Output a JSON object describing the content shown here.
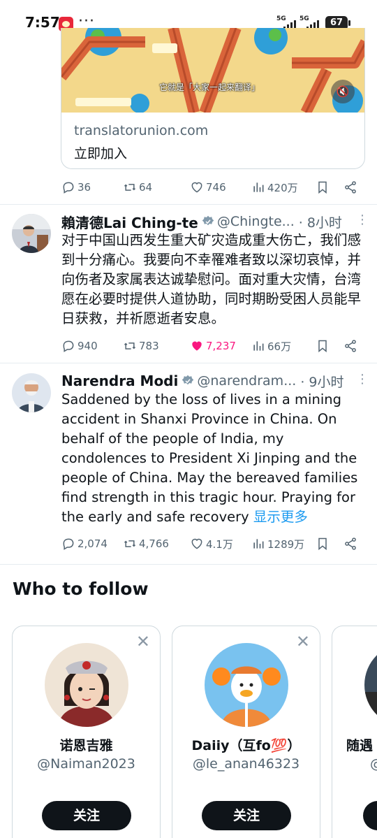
{
  "status_bar": {
    "time": "7:57",
    "dots": "···",
    "network1": "5G",
    "network2": "5G",
    "battery": "67"
  },
  "embed_card": {
    "subtitle": "它就是「大家一起来翻译」",
    "domain": "translatorunion.com",
    "title": "立即加入"
  },
  "tweet0_actions": {
    "replies": "36",
    "retweets": "64",
    "likes": "746",
    "views": "420万"
  },
  "tweets": [
    {
      "name": "賴清德Lai Ching-te",
      "handle": "@Chingte...",
      "time": "· 8小时",
      "more": "⋮",
      "text": "对于中国山西发生重大矿灾造成重大伤亡，我们感到十分痛心。我要向不幸罹难者致以深切哀悼，并向伤者及家属表达诚挚慰问。面对重大灾情，台湾愿在必要时提供人道协助，同时期盼受困人员能早日获救，并祈愿逝者安息。",
      "replies": "940",
      "retweets": "783",
      "likes": "7,237",
      "views": "66万"
    },
    {
      "name": "Narendra Modi",
      "handle": "@narendram...",
      "time": "· 9小时",
      "more": "⋮",
      "text": "Saddened by the loss of lives in a mining accident in Shanxi Province in China. On behalf of the people of India, my condolences to President Xi Jinping and the people of China. May the bereaved families find strength in this tragic hour. Praying for the early and safe recovery ",
      "show_more": "显示更多",
      "replies": "2,074",
      "retweets": "4,766",
      "likes": "4.1万",
      "views": "1289万"
    }
  ],
  "who_to_follow": {
    "title": "Who to follow",
    "close": "✕",
    "cards": [
      {
        "name": "诺恩吉雅",
        "handle": "@Naiman2023",
        "button": "关注"
      },
      {
        "name": "Daiiy（互fo💯）",
        "handle": "@le_anan46323",
        "button": "关注"
      },
      {
        "name": "随遇",
        "handle": "@",
        "button": ""
      }
    ]
  },
  "colors": {
    "accent": "#1d9bf0",
    "like": "#f91880",
    "muted": "#536471",
    "text": "#0f1419"
  }
}
